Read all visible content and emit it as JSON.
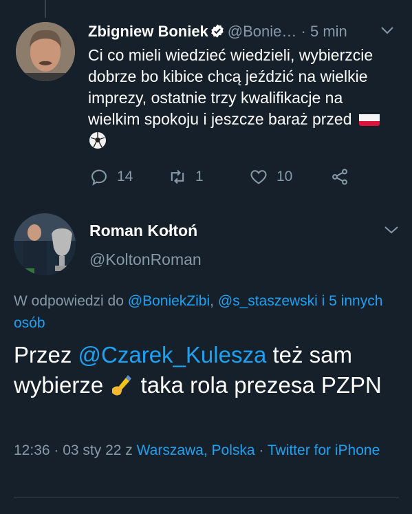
{
  "parent_tweet": {
    "author_name": "Zbigniew Boniek",
    "handle": "@Bonie…",
    "time": "· 5 min",
    "text": "Ci co mieli wiedzieć wiedzieli, wybierzcie dobrze bo kibice chcą jeździć na wielkie imprezy, ostatnie trzy kwalifikacje na wielkim spokoju i jeszcze baraż przed",
    "replies": "14",
    "retweets": "1",
    "likes": "10"
  },
  "main_tweet": {
    "author_name": "Roman Kołtoń",
    "handle": "@KoltonRoman",
    "reply_prefix": "W odpowiedzi do ",
    "reply_mention_1": "@BoniekZibi",
    "reply_sep": ", ",
    "reply_mention_2": "@s_staszewski i 5 innych osób",
    "text_1": "Przez ",
    "mention": "@Czarek_Kulesza",
    "text_2": " też sam wybierze ",
    "text_3": " taka rola prezesa PZPN",
    "datetime": "12:36 · 03 sty 22 z ",
    "location": "Warszawa, Polska",
    "sep": " · ",
    "source": "Twitter for iPhone"
  },
  "colors": {
    "background": "#15202b",
    "text": "#ffffff",
    "muted": "#8899a6",
    "link": "#1da1f2",
    "divider": "#38444d"
  },
  "icons": [
    "verified-icon",
    "chevron-down-icon",
    "reply-icon",
    "retweet-icon",
    "like-icon",
    "share-icon",
    "poland-flag-emoji",
    "soccer-ball-emoji",
    "writing-hand-emoji"
  ]
}
